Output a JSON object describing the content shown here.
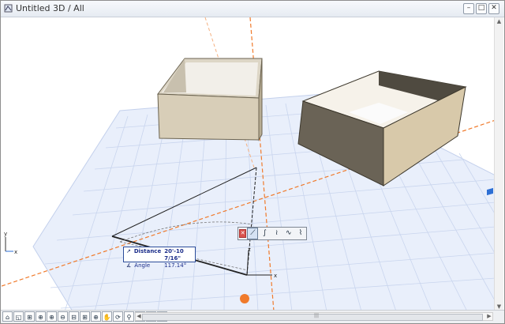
{
  "window": {
    "title": "Untitled 3D / All",
    "buttons": {
      "minimize": "–",
      "maximize": "□",
      "close": "✕"
    }
  },
  "palette": {
    "close": "✕",
    "tools": [
      "⟋",
      "∫",
      "≀",
      "∿",
      "⌇"
    ]
  },
  "tracker": {
    "distance_icon": "↗",
    "distance_label": "Distance",
    "distance_value": "20'-10 7/16\"",
    "angle_icon": "∡",
    "angle_label": "Angle",
    "angle_value": "117.14°"
  },
  "axes": {
    "x": "x",
    "y": "y",
    "z": "z"
  },
  "statusbar": {
    "nav_tools": [
      "⌂",
      "◱",
      "⊞",
      "⊕",
      "⊕",
      "⊖",
      "⊟",
      "⊞",
      "⊕",
      "✋",
      "⟳",
      "⚲",
      "⚐",
      "⤺",
      "⟲"
    ]
  },
  "colors": {
    "grid_fill": "#e7eefc",
    "grid_line": "#c3d0ec",
    "guide_orange": "#f07a2b",
    "tracker_blue": "#2b4c9a"
  }
}
